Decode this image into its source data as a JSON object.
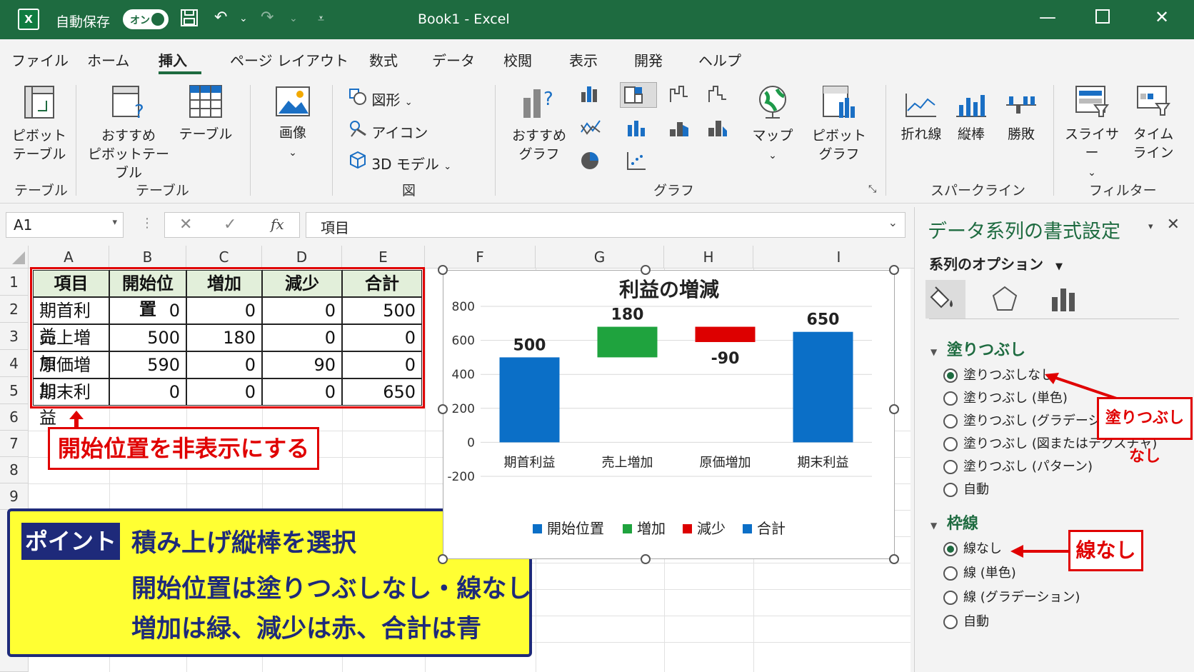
{
  "titlebar": {
    "logo": "X",
    "autosave_label": "自動保存",
    "toggle_label": "オン",
    "title": "Book1  -  Excel"
  },
  "menu": {
    "tabs": [
      "ファイル",
      "ホーム",
      "挿入",
      "ページ レイアウト",
      "数式",
      "データ",
      "校閲",
      "表示",
      "開発",
      "ヘルプ"
    ],
    "active": "挿入"
  },
  "ribbon": {
    "pivot_table": "ピボット\nテーブル",
    "recommended_pivot": "おすすめ\nピボットテーブル",
    "table": "テーブル",
    "image": "画像",
    "shapes": "図形",
    "icons": "アイコン",
    "model3d": "3D モデル",
    "recommended_chart": "おすすめ\nグラフ",
    "map": "マップ",
    "pivot_chart": "ピボット\nグラフ",
    "spark_line": "折れ線",
    "spark_column": "縦棒",
    "spark_winloss": "勝敗",
    "slicer": "スライサー",
    "timeline": "タイム\nライン",
    "groups": {
      "table1": "テーブル",
      "table2": "テーブル",
      "figure": "図",
      "chart": "グラフ",
      "sparkline": "スパークライン",
      "filter": "フィルター"
    }
  },
  "formula_bar": {
    "name_box": "A1",
    "fx": "fx",
    "content": "項目"
  },
  "sheet": {
    "columns": [
      "A",
      "B",
      "C",
      "D",
      "E",
      "F",
      "G",
      "H",
      "I"
    ],
    "rows": [
      "1",
      "2",
      "3",
      "4",
      "5",
      "6",
      "7",
      "8",
      "9"
    ],
    "table": {
      "header": [
        "項目",
        "開始位置",
        "増加",
        "減少",
        "合計"
      ],
      "rows": [
        [
          "期首利益",
          "0",
          "0",
          "0",
          "500"
        ],
        [
          "売上増加",
          "500",
          "180",
          "0",
          "0"
        ],
        [
          "原価増加",
          "590",
          "0",
          "90",
          "0"
        ],
        [
          "期末利益",
          "0",
          "0",
          "0",
          "650"
        ]
      ]
    },
    "callout": "開始位置を非表示にする",
    "point": {
      "tag": "ポイント",
      "lines": [
        "積み上げ縦棒を選択",
        "開始位置は塗りつぶしなし・線なし",
        "増加は緑、減少は赤、合計は青"
      ]
    }
  },
  "chart_data": {
    "type": "bar",
    "title": "利益の増減",
    "categories": [
      "期首利益",
      "売上増加",
      "原価増加",
      "期末利益"
    ],
    "stacked": true,
    "series": [
      {
        "name": "開始位置",
        "values": [
          0,
          500,
          590,
          0
        ],
        "color": "#0b6fc7",
        "visible": false
      },
      {
        "name": "増加",
        "values": [
          0,
          180,
          0,
          0
        ],
        "color": "#1fa33e"
      },
      {
        "name": "減少",
        "values": [
          0,
          0,
          90,
          0
        ],
        "color": "#dd0000"
      },
      {
        "name": "合計",
        "values": [
          500,
          0,
          0,
          650
        ],
        "color": "#0b6fc7"
      }
    ],
    "data_labels": [
      "500",
      "180",
      "-90",
      "650"
    ],
    "yticks": [
      "800",
      "600",
      "400",
      "200",
      "0",
      "-200"
    ],
    "ylim": [
      -200,
      800
    ],
    "grid": true,
    "legend": "bottom"
  },
  "pane": {
    "title": "データ系列の書式設定",
    "subtitle": "系列のオプション",
    "fill_section": "塗りつぶし",
    "fill_options": [
      "塗りつぶしなし",
      "塗りつぶし (単色)",
      "塗りつぶし (グラデーション)",
      "塗りつぶし (図またはテクスチャ)",
      "塗りつぶし (パターン)",
      "自動"
    ],
    "fill_selected": 0,
    "line_section": "枠線",
    "line_options": [
      "線なし",
      "線 (単色)",
      "線 (グラデーション)",
      "自動"
    ],
    "line_selected": 0,
    "callout_fill": "塗りつぶしなし",
    "callout_line": "線なし"
  }
}
